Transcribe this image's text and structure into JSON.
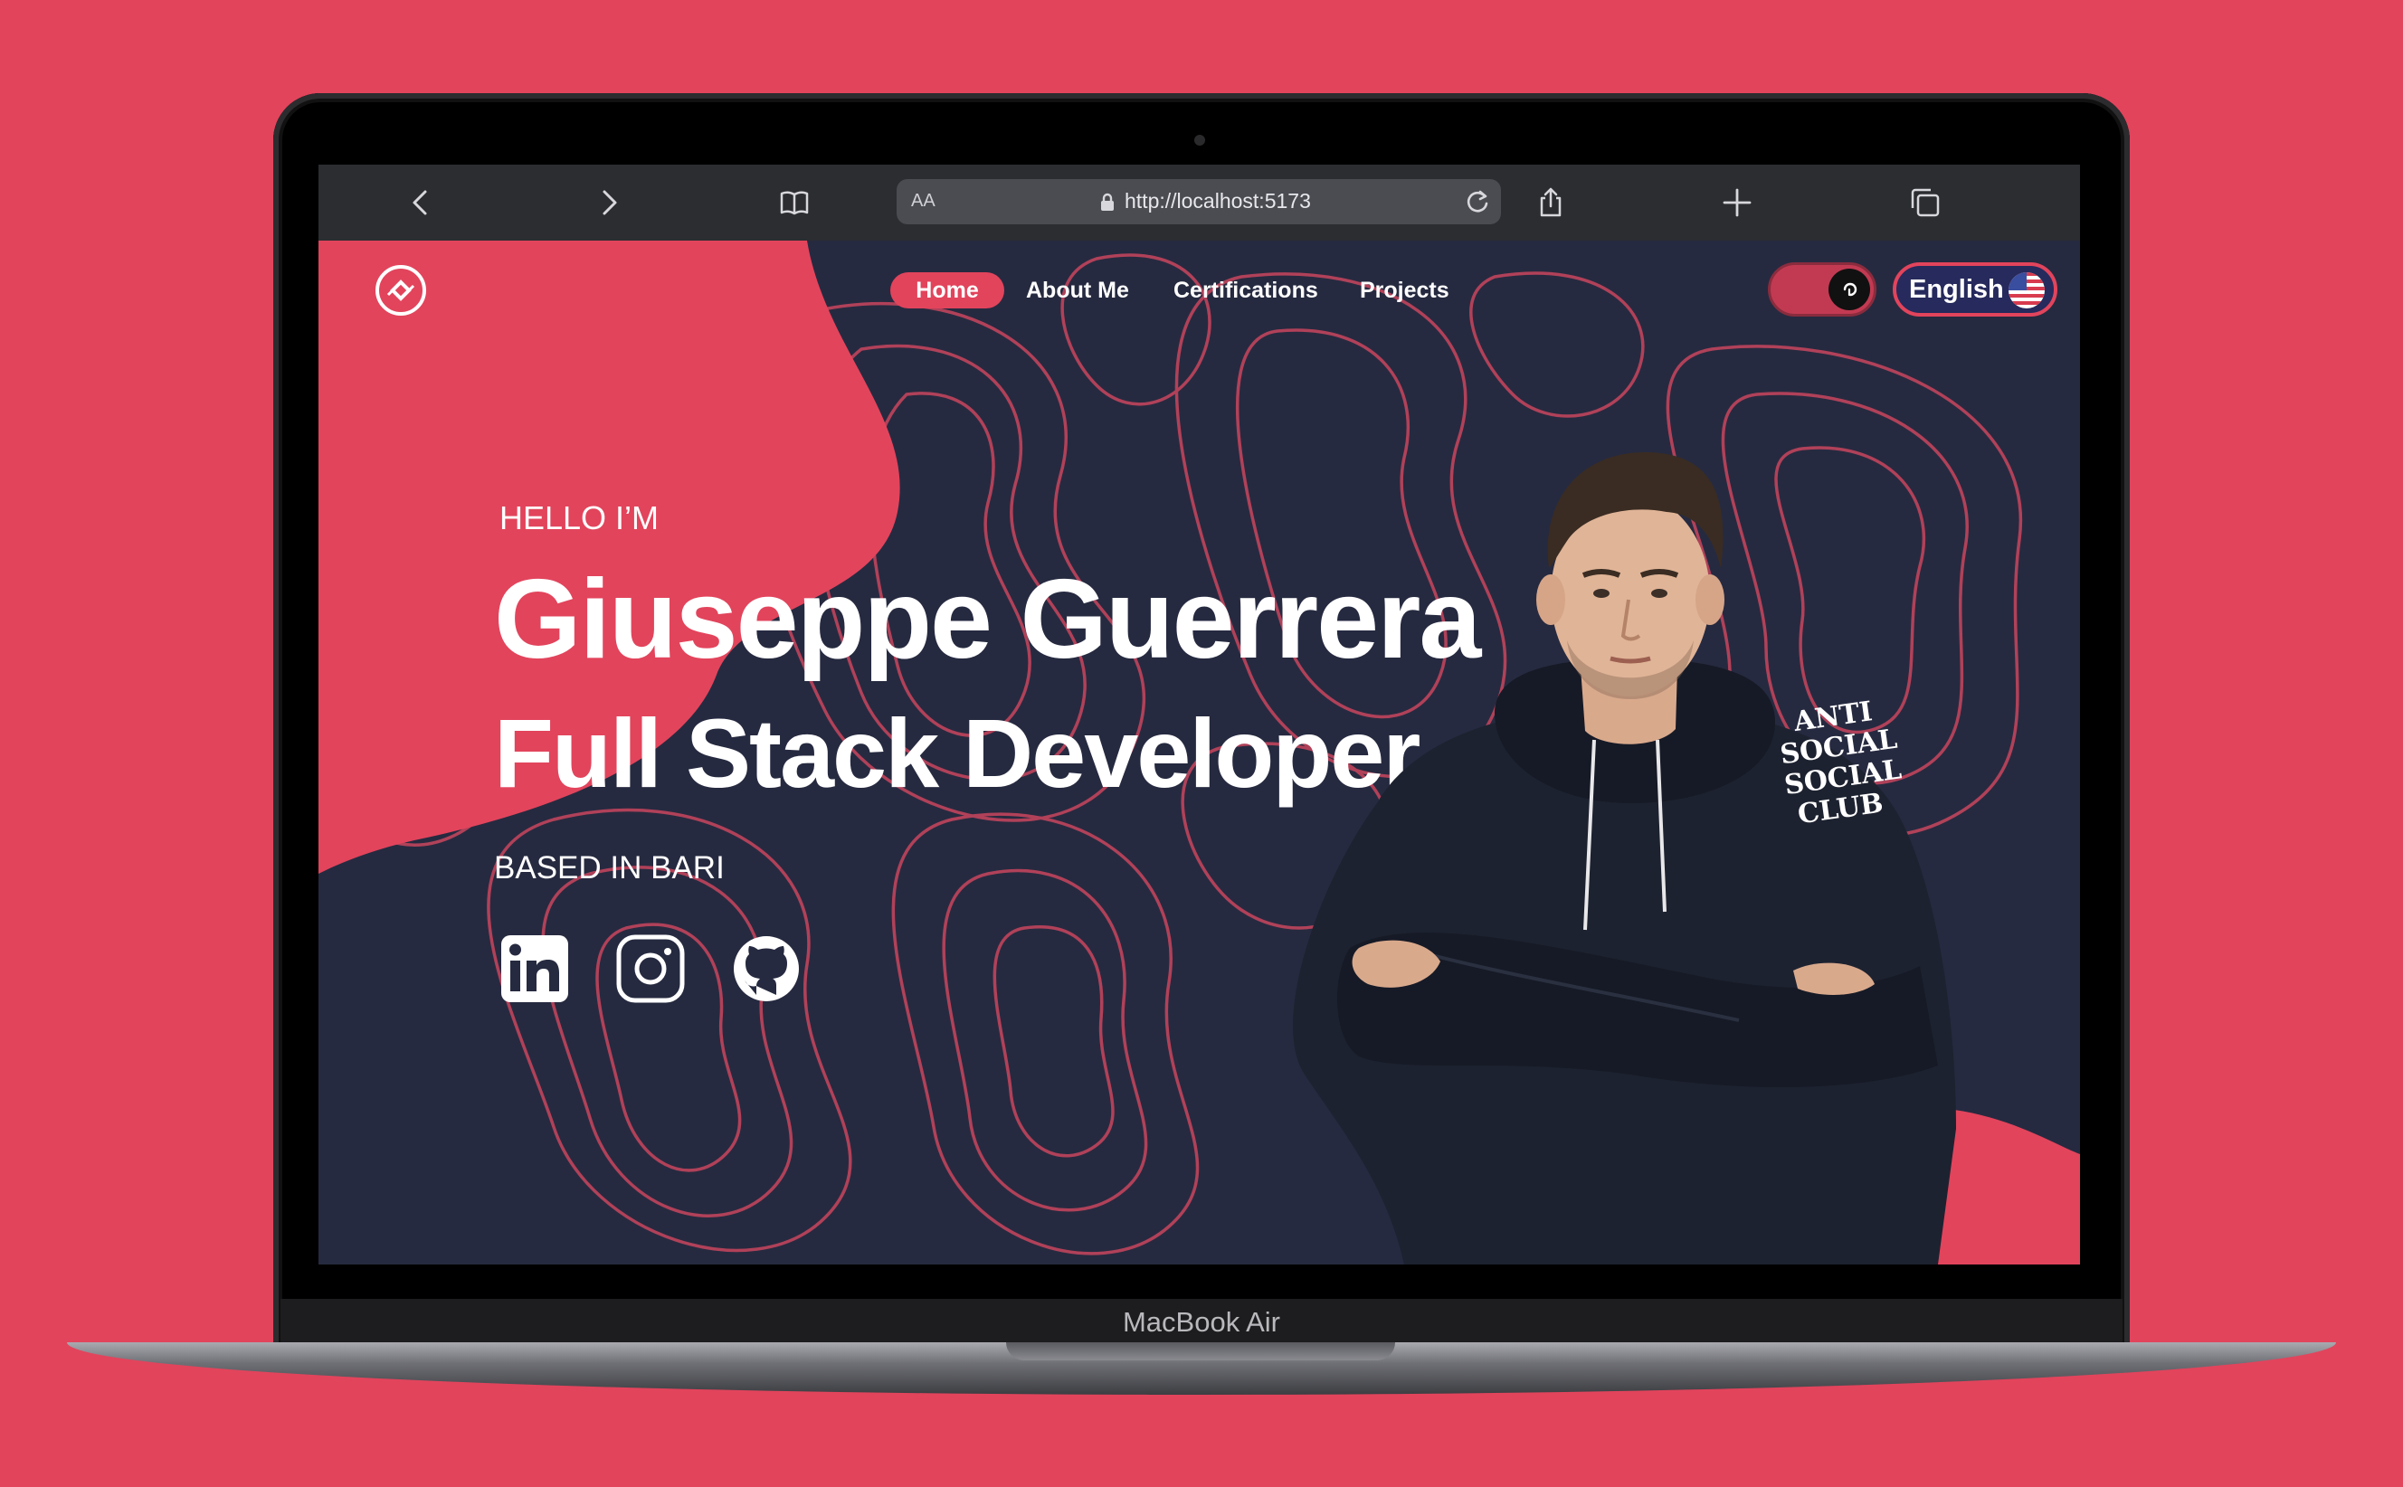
{
  "device": {
    "label": "MacBook Air"
  },
  "browser": {
    "url": "http://localhost:5173",
    "aa_label": "AA",
    "icons": [
      "back-icon",
      "forward-icon",
      "bookmarks-icon",
      "lock-icon",
      "reload-icon",
      "share-icon",
      "new-tab-icon",
      "tabs-icon"
    ]
  },
  "nav": {
    "items": [
      {
        "label": "Home",
        "active": true
      },
      {
        "label": "About Me",
        "active": false
      },
      {
        "label": "Certifications",
        "active": false
      },
      {
        "label": "Projects",
        "active": false
      }
    ],
    "language": "English",
    "theme_toggle": "dark"
  },
  "hero": {
    "greeting": "HELLO I’M",
    "name": "Giuseppe Guerrera",
    "role": "Full Stack Developer",
    "location": "BASED IN BARI",
    "socials": [
      "linkedin-icon",
      "instagram-icon",
      "github-icon"
    ],
    "hoodie_text": [
      "ANTI",
      "SOCIAL",
      "SOCIAL",
      "CLUB"
    ]
  },
  "colors": {
    "accent": "#e2445c",
    "dark": "#262a40",
    "toolbar": "#2b2d31"
  }
}
